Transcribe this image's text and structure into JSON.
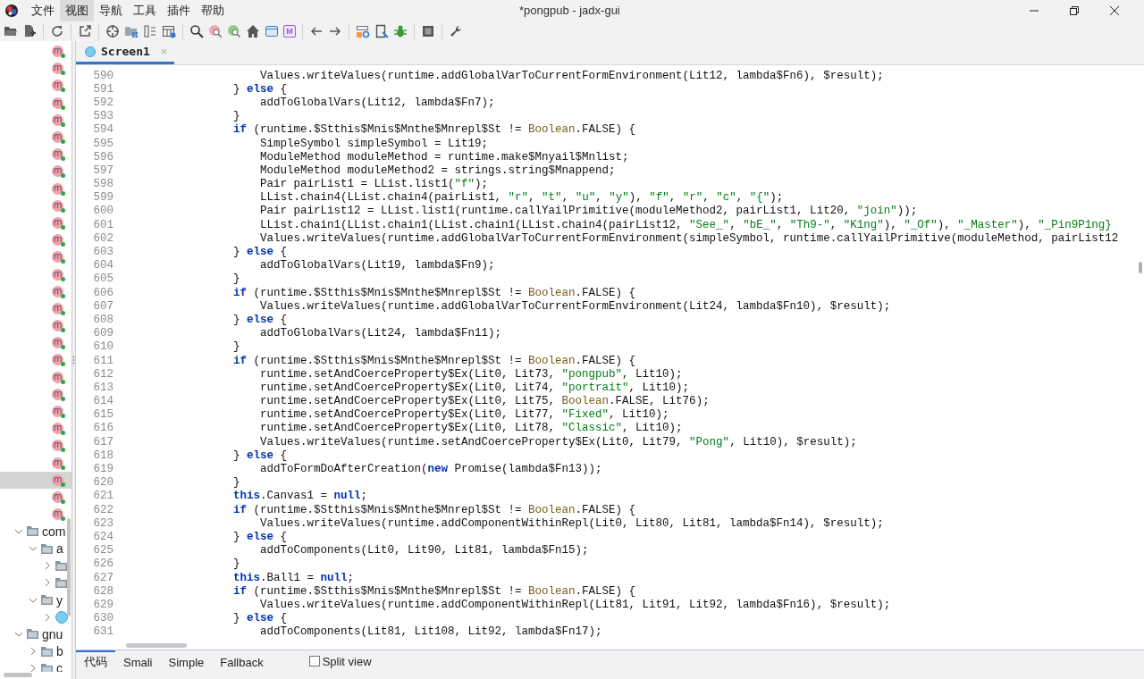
{
  "window": {
    "title": "*pongpub - jadx-gui"
  },
  "menu": [
    {
      "label": "文件",
      "selected": false
    },
    {
      "label": "视图",
      "selected": true
    },
    {
      "label": "导航",
      "selected": false
    },
    {
      "label": "工具",
      "selected": false
    },
    {
      "label": "插件",
      "selected": false
    },
    {
      "label": "帮助",
      "selected": false
    }
  ],
  "toolbar": [
    {
      "kind": "open"
    },
    {
      "kind": "add-file"
    },
    {
      "kind": "sep"
    },
    {
      "kind": "refresh"
    },
    {
      "kind": "sep"
    },
    {
      "kind": "export"
    },
    {
      "kind": "sep"
    },
    {
      "kind": "crosshair"
    },
    {
      "kind": "folder-grid"
    },
    {
      "kind": "columns"
    },
    {
      "kind": "table"
    },
    {
      "kind": "sep"
    },
    {
      "kind": "search"
    },
    {
      "kind": "search-pink"
    },
    {
      "kind": "search-green"
    },
    {
      "kind": "home"
    },
    {
      "kind": "window"
    },
    {
      "kind": "letter-box",
      "label": "M"
    },
    {
      "kind": "sep"
    },
    {
      "kind": "back"
    },
    {
      "kind": "forward"
    },
    {
      "kind": "sep"
    },
    {
      "kind": "lock-gear"
    },
    {
      "kind": "doc-arrow"
    },
    {
      "kind": "bug"
    },
    {
      "kind": "sep"
    },
    {
      "kind": "stop"
    },
    {
      "kind": "sep"
    },
    {
      "kind": "wrench"
    }
  ],
  "sidebar": {
    "items": [
      {
        "kind": "method",
        "label": "m",
        "selected": false
      },
      {
        "kind": "method",
        "label": "m",
        "selected": false
      },
      {
        "kind": "method",
        "label": "m",
        "selected": false
      },
      {
        "kind": "method",
        "label": "m",
        "selected": false
      },
      {
        "kind": "method",
        "label": "m",
        "selected": false
      },
      {
        "kind": "method",
        "label": "m",
        "selected": false
      },
      {
        "kind": "method",
        "label": "m",
        "selected": false
      },
      {
        "kind": "method",
        "label": "m",
        "selected": false
      },
      {
        "kind": "method",
        "label": "m",
        "selected": false
      },
      {
        "kind": "method",
        "label": "m",
        "selected": false
      },
      {
        "kind": "method",
        "label": "m",
        "selected": false
      },
      {
        "kind": "method",
        "label": "m",
        "selected": false
      },
      {
        "kind": "method",
        "label": "m",
        "selected": false
      },
      {
        "kind": "method",
        "label": "m",
        "selected": false
      },
      {
        "kind": "method",
        "label": "m",
        "selected": false
      },
      {
        "kind": "method",
        "label": "m",
        "selected": false
      },
      {
        "kind": "method",
        "label": "m",
        "selected": false
      },
      {
        "kind": "method",
        "label": "m",
        "selected": false
      },
      {
        "kind": "method",
        "label": "m",
        "selected": false
      },
      {
        "kind": "method",
        "label": "m",
        "selected": false
      },
      {
        "kind": "method",
        "label": "m",
        "selected": false
      },
      {
        "kind": "method",
        "label": "m",
        "selected": false
      },
      {
        "kind": "method",
        "label": "m",
        "selected": false
      },
      {
        "kind": "method",
        "label": "m",
        "selected": false
      },
      {
        "kind": "method",
        "label": "m",
        "selected": false
      },
      {
        "kind": "method",
        "label": "m",
        "selected": true
      },
      {
        "kind": "method",
        "label": "m",
        "selected": false
      },
      {
        "kind": "method",
        "label": "m",
        "selected": false
      },
      {
        "kind": "package",
        "label": "com",
        "expanded": true,
        "selected": false,
        "children": [
          {
            "kind": "package",
            "label": "a",
            "expanded": true,
            "selected": false,
            "children": [
              {
                "kind": "package",
                "expanded": false,
                "selected": false
              },
              {
                "kind": "package",
                "expanded": false,
                "selected": false
              }
            ]
          },
          {
            "kind": "package",
            "label": "y",
            "expanded": true,
            "selected": false,
            "children": [
              {
                "kind": "class",
                "expanded": false,
                "selected": false
              }
            ]
          }
        ]
      },
      {
        "kind": "package",
        "label": "gnu",
        "expanded": true,
        "selected": false,
        "children": [
          {
            "kind": "package",
            "label": "b",
            "expanded": false,
            "selected": false
          },
          {
            "kind": "package",
            "label": "c",
            "expanded": false,
            "selected": false
          }
        ]
      }
    ]
  },
  "tabs": [
    {
      "label": "Screen1",
      "selected": true,
      "close": "×"
    }
  ],
  "code": {
    "lines": [
      {
        "number": "590",
        "tokens": [
          "                    Values.writeValues(runtime.addGlobalVarToCurrentFormEnvironment(Lit12, lambda$Fn6), $result);"
        ]
      },
      {
        "number": "591",
        "tokens": [
          "                } ",
          {
            "kind": "keyword",
            "text": "else"
          },
          " {"
        ]
      },
      {
        "number": "592",
        "tokens": [
          "                    addToGlobalVars(Lit12, lambda$Fn7);"
        ]
      },
      {
        "number": "593",
        "tokens": [
          "                }"
        ]
      },
      {
        "number": "594",
        "tokens": [
          {
            "kind": "keyword",
            "text": "                if"
          },
          " (runtime.$Stthis$Mnis$Mnthe$Mnrepl$St != ",
          {
            "kind": "type",
            "text": "Boolean"
          },
          ".FALSE) {"
        ]
      },
      {
        "number": "595",
        "tokens": [
          "                    SimpleSymbol simpleSymbol = Lit19;"
        ]
      },
      {
        "number": "596",
        "tokens": [
          "                    ModuleMethod moduleMethod = runtime.make$Mnyail$Mnlist;"
        ]
      },
      {
        "number": "597",
        "tokens": [
          "                    ModuleMethod moduleMethod2 = strings.string$Mnappend;"
        ]
      },
      {
        "number": "598",
        "tokens": [
          "                    Pair pairList1 = LList.list1(",
          {
            "kind": "string",
            "text": "\"f\""
          },
          ");"
        ]
      },
      {
        "number": "599",
        "tokens": [
          "                    LList.chain4(LList.chain4(pairList1, ",
          {
            "kind": "string",
            "text": "\"r\""
          },
          ", ",
          {
            "kind": "string",
            "text": "\"t\""
          },
          ", ",
          {
            "kind": "string",
            "text": "\"u\""
          },
          ", ",
          {
            "kind": "string",
            "text": "\"y\""
          },
          "), ",
          {
            "kind": "string",
            "text": "\"f\""
          },
          ", ",
          {
            "kind": "string",
            "text": "\"r\""
          },
          ", ",
          {
            "kind": "string",
            "text": "\"c\""
          },
          ", ",
          {
            "kind": "string",
            "text": "\"{\""
          },
          ");"
        ]
      },
      {
        "number": "600",
        "tokens": [
          "                    Pair pairList12 = LList.list1(runtime.callYailPrimitive(moduleMethod2, pairList1, Lit20, ",
          {
            "kind": "string",
            "text": "\"join\""
          },
          "));"
        ]
      },
      {
        "number": "601",
        "tokens": [
          "                    LList.chain1(LList.chain1(LList.chain1(LList.chain4(pairList12, ",
          {
            "kind": "string",
            "text": "\"See_\""
          },
          ", ",
          {
            "kind": "string",
            "text": "\"bE_\""
          },
          ", ",
          {
            "kind": "string",
            "text": "\"Th9-\""
          },
          ", ",
          {
            "kind": "string",
            "text": "\"K1ng\""
          },
          "), ",
          {
            "kind": "string",
            "text": "\"_Of\""
          },
          "), ",
          {
            "kind": "string",
            "text": "\"_Master\""
          },
          "), ",
          {
            "kind": "string",
            "text": "\"_Pin9P1ng}"
          }
        ]
      },
      {
        "number": "602",
        "tokens": [
          "                    Values.writeValues(runtime.addGlobalVarToCurrentFormEnvironment(simpleSymbol, runtime.callYailPrimitive(moduleMethod, pairList12"
        ]
      },
      {
        "number": "603",
        "tokens": [
          "                } ",
          {
            "kind": "keyword",
            "text": "else"
          },
          " {"
        ]
      },
      {
        "number": "604",
        "tokens": [
          "                    addToGlobalVars(Lit19, lambda$Fn9);"
        ]
      },
      {
        "number": "605",
        "tokens": [
          "                }"
        ]
      },
      {
        "number": "606",
        "tokens": [
          {
            "kind": "keyword",
            "text": "                if"
          },
          " (runtime.$Stthis$Mnis$Mnthe$Mnrepl$St != ",
          {
            "kind": "type",
            "text": "Boolean"
          },
          ".FALSE) {"
        ]
      },
      {
        "number": "607",
        "tokens": [
          "                    Values.writeValues(runtime.addGlobalVarToCurrentFormEnvironment(Lit24, lambda$Fn10), $result);"
        ]
      },
      {
        "number": "608",
        "tokens": [
          "                } ",
          {
            "kind": "keyword",
            "text": "else"
          },
          " {"
        ]
      },
      {
        "number": "609",
        "tokens": [
          "                    addToGlobalVars(Lit24, lambda$Fn11);"
        ]
      },
      {
        "number": "610",
        "tokens": [
          "                }"
        ]
      },
      {
        "number": "611",
        "tokens": [
          {
            "kind": "keyword",
            "text": "                if"
          },
          " (runtime.$Stthis$Mnis$Mnthe$Mnrepl$St != ",
          {
            "kind": "type",
            "text": "Boolean"
          },
          ".FALSE) {"
        ]
      },
      {
        "number": "612",
        "tokens": [
          "                    runtime.setAndCoerceProperty$Ex(Lit0, Lit73, ",
          {
            "kind": "string",
            "text": "\"pongpub\""
          },
          ", Lit10);"
        ]
      },
      {
        "number": "613",
        "tokens": [
          "                    runtime.setAndCoerceProperty$Ex(Lit0, Lit74, ",
          {
            "kind": "string",
            "text": "\"portrait\""
          },
          ", Lit10);"
        ]
      },
      {
        "number": "614",
        "tokens": [
          "                    runtime.setAndCoerceProperty$Ex(Lit0, Lit75, ",
          {
            "kind": "type",
            "text": "Boolean"
          },
          ".FALSE, Lit76);"
        ]
      },
      {
        "number": "615",
        "tokens": [
          "                    runtime.setAndCoerceProperty$Ex(Lit0, Lit77, ",
          {
            "kind": "string",
            "text": "\"Fixed\""
          },
          ", Lit10);"
        ]
      },
      {
        "number": "616",
        "tokens": [
          "                    runtime.setAndCoerceProperty$Ex(Lit0, Lit78, ",
          {
            "kind": "string",
            "text": "\"Classic\""
          },
          ", Lit10);"
        ]
      },
      {
        "number": "617",
        "tokens": [
          "                    Values.writeValues(runtime.setAndCoerceProperty$Ex(Lit0, Lit79, ",
          {
            "kind": "string",
            "text": "\"Pong\""
          },
          ", Lit10), $result);"
        ]
      },
      {
        "number": "618",
        "tokens": [
          "                } ",
          {
            "kind": "keyword",
            "text": "else"
          },
          " {"
        ]
      },
      {
        "number": "619",
        "tokens": [
          "                    addToFormDoAfterCreation(",
          {
            "kind": "keyword",
            "text": "new"
          },
          " Promise(lambda$Fn13));"
        ]
      },
      {
        "number": "620",
        "tokens": [
          "                }"
        ]
      },
      {
        "number": "621",
        "tokens": [
          {
            "kind": "keyword",
            "text": "                this"
          },
          ".Canvas1 = ",
          {
            "kind": "keyword",
            "text": "null"
          },
          ";"
        ]
      },
      {
        "number": "622",
        "tokens": [
          {
            "kind": "keyword",
            "text": "                if"
          },
          " (runtime.$Stthis$Mnis$Mnthe$Mnrepl$St != ",
          {
            "kind": "type",
            "text": "Boolean"
          },
          ".FALSE) {"
        ]
      },
      {
        "number": "623",
        "tokens": [
          "                    Values.writeValues(runtime.addComponentWithinRepl(Lit0, Lit80, Lit81, lambda$Fn14), $result);"
        ]
      },
      {
        "number": "624",
        "tokens": [
          "                } ",
          {
            "kind": "keyword",
            "text": "else"
          },
          " {"
        ]
      },
      {
        "number": "625",
        "tokens": [
          "                    addToComponents(Lit0, Lit90, Lit81, lambda$Fn15);"
        ]
      },
      {
        "number": "626",
        "tokens": [
          "                }"
        ]
      },
      {
        "number": "627",
        "tokens": [
          {
            "kind": "keyword",
            "text": "                this"
          },
          ".Ball1 = ",
          {
            "kind": "keyword",
            "text": "null"
          },
          ";"
        ]
      },
      {
        "number": "628",
        "tokens": [
          {
            "kind": "keyword",
            "text": "                if"
          },
          " (runtime.$Stthis$Mnis$Mnthe$Mnrepl$St != ",
          {
            "kind": "type",
            "text": "Boolean"
          },
          ".FALSE) {"
        ]
      },
      {
        "number": "629",
        "tokens": [
          "                    Values.writeValues(runtime.addComponentWithinRepl(Lit81, Lit91, Lit92, lambda$Fn16), $result);"
        ]
      },
      {
        "number": "630",
        "tokens": [
          "                } ",
          {
            "kind": "keyword",
            "text": "else"
          },
          " {"
        ]
      },
      {
        "number": "631",
        "tokens": [
          "                    addToComponents(Lit81, Lit108, Lit92, lambda$Fn17);"
        ]
      }
    ]
  },
  "view_tabs": [
    {
      "label": "代码",
      "selected": true
    },
    {
      "label": "Smali",
      "selected": false
    },
    {
      "label": "Simple",
      "selected": false
    },
    {
      "label": "Fallback",
      "selected": false
    }
  ],
  "split_view": {
    "label": "Split view",
    "checked": false
  }
}
